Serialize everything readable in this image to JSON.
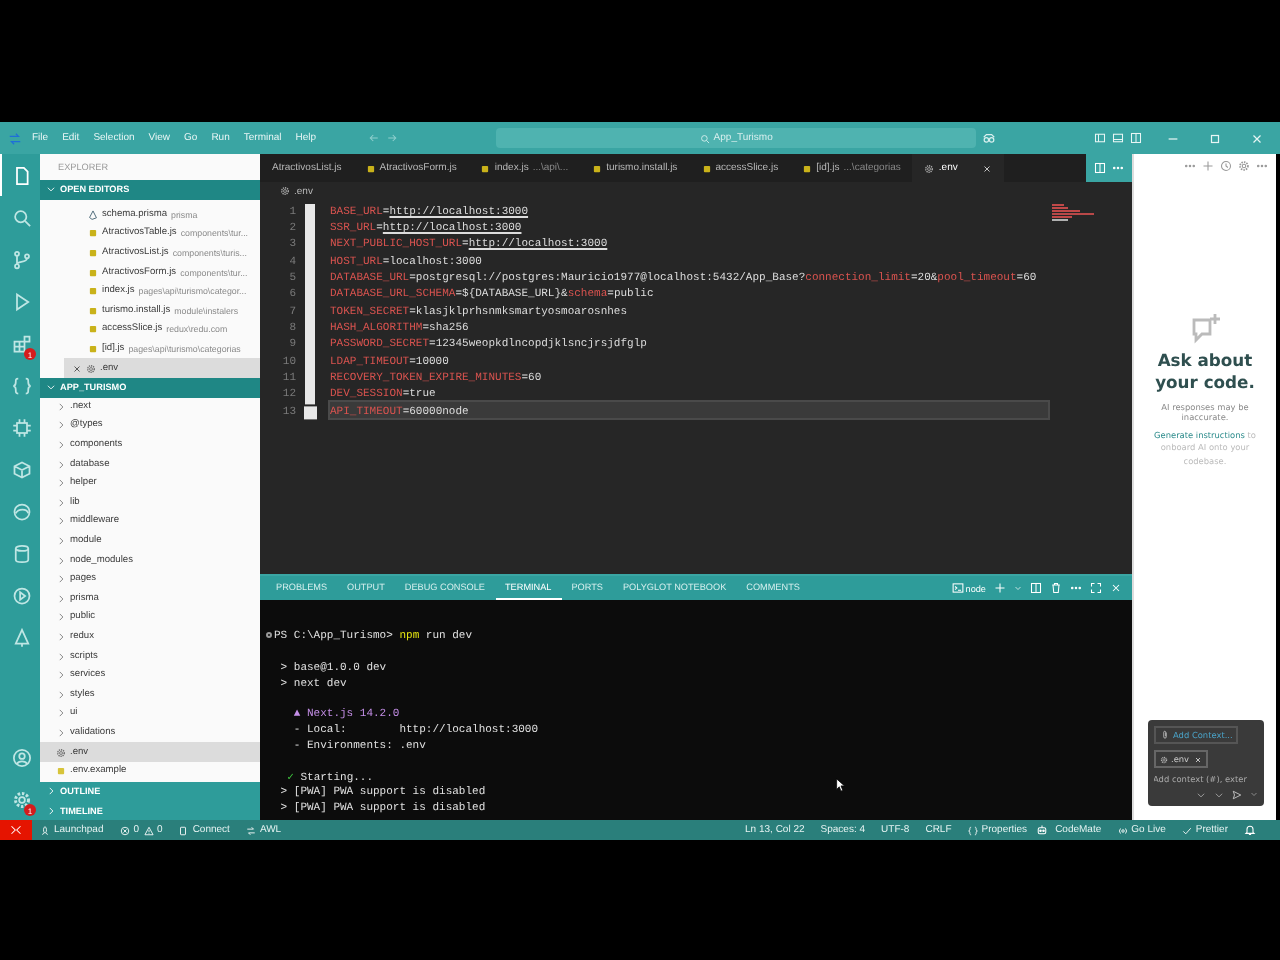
{
  "window": {
    "menu": [
      "File",
      "Edit",
      "Selection",
      "View",
      "Go",
      "Run",
      "Terminal",
      "Help"
    ],
    "search": "App_Turismo"
  },
  "activity_bar": {
    "top": [
      {
        "kind": "files",
        "selected": true
      },
      {
        "kind": "search",
        "selected": false
      },
      {
        "kind": "source-control",
        "selected": false
      },
      {
        "kind": "run",
        "selected": false
      },
      {
        "kind": "extensions",
        "selected": false,
        "badge": "1"
      },
      {
        "kind": "braces",
        "selected": false
      },
      {
        "kind": "chip",
        "selected": false
      },
      {
        "kind": "package",
        "selected": false
      },
      {
        "kind": "browser",
        "selected": false
      },
      {
        "kind": "database",
        "selected": false
      },
      {
        "kind": "play",
        "selected": false
      },
      {
        "kind": "tree",
        "selected": false
      }
    ],
    "bottom": [
      {
        "kind": "account",
        "selected": false
      },
      {
        "kind": "settings",
        "selected": false,
        "badge": "1"
      }
    ]
  },
  "sidebar": {
    "title": "EXPLORER",
    "open_editors": {
      "title": "OPEN EDITORS",
      "expanded": true,
      "items": [
        {
          "name": "schema.prisma",
          "path": "prisma",
          "kind": "prisma",
          "selected": false
        },
        {
          "name": "AtractivosTable.js",
          "path": "components\\tur...",
          "kind": "js",
          "selected": false
        },
        {
          "name": "AtractivosList.js",
          "path": "components\\turis...",
          "kind": "js",
          "selected": false
        },
        {
          "name": "AtractivosForm.js",
          "path": "components\\tur...",
          "kind": "js",
          "selected": false
        },
        {
          "name": "index.js",
          "path": "pages\\api\\turismo\\categor...",
          "kind": "js",
          "selected": false
        },
        {
          "name": "turismo.install.js",
          "path": "module\\instalers",
          "kind": "js",
          "selected": false
        },
        {
          "name": "accessSlice.js",
          "path": "redux\\redu.com",
          "kind": "js",
          "selected": false
        },
        {
          "name": "[id].js",
          "path": "pages\\api\\turismo\\categorias",
          "kind": "js",
          "selected": false
        },
        {
          "name": ".env",
          "kind": "env",
          "selected": true
        }
      ]
    },
    "project": {
      "title": "APP_TURISMO",
      "expanded": true,
      "items": [
        {
          "name": ".next",
          "kind": "folder",
          "expanded": false,
          "selected": false
        },
        {
          "name": "@types",
          "kind": "folder",
          "expanded": false,
          "selected": false
        },
        {
          "name": "components",
          "kind": "folder",
          "expanded": false,
          "selected": false
        },
        {
          "name": "database",
          "kind": "folder",
          "expanded": false,
          "selected": false
        },
        {
          "name": "helper",
          "kind": "folder",
          "expanded": false,
          "selected": false
        },
        {
          "name": "lib",
          "kind": "folder",
          "expanded": false,
          "selected": false
        },
        {
          "name": "middleware",
          "kind": "folder",
          "expanded": false,
          "selected": false
        },
        {
          "name": "module",
          "kind": "folder",
          "expanded": false,
          "selected": false
        },
        {
          "name": "node_modules",
          "kind": "folder",
          "expanded": false,
          "selected": false
        },
        {
          "name": "pages",
          "kind": "folder",
          "expanded": false,
          "selected": false
        },
        {
          "name": "prisma",
          "kind": "folder",
          "expanded": false,
          "selected": false
        },
        {
          "name": "public",
          "kind": "folder",
          "expanded": false,
          "selected": false
        },
        {
          "name": "redux",
          "kind": "folder",
          "expanded": false,
          "selected": false
        },
        {
          "name": "scripts",
          "kind": "folder",
          "expanded": false,
          "selected": false
        },
        {
          "name": "services",
          "kind": "folder",
          "expanded": false,
          "selected": false
        },
        {
          "name": "styles",
          "kind": "folder",
          "expanded": false,
          "selected": false
        },
        {
          "name": "ui",
          "kind": "folder",
          "expanded": false,
          "selected": false
        },
        {
          "name": "validations",
          "kind": "folder",
          "expanded": false,
          "selected": false
        },
        {
          "name": ".env",
          "kind": "env",
          "selected": true
        },
        {
          "name": ".env.example",
          "kind": "example",
          "selected": false
        }
      ]
    },
    "sections": [
      {
        "title": "OUTLINE",
        "expanded": false
      },
      {
        "title": "TIMELINE",
        "expanded": false
      }
    ]
  },
  "editor": {
    "tabs": [
      {
        "name": "AtractivosList.js",
        "selected": false
      },
      {
        "name": "AtractivosForm.js",
        "kind": "js",
        "selected": false
      },
      {
        "name": "index.js",
        "detail": "...\\api\\...",
        "kind": "js",
        "selected": false
      },
      {
        "name": "turismo.install.js",
        "kind": "js",
        "selected": false
      },
      {
        "name": "accessSlice.js",
        "kind": "js",
        "selected": false
      },
      {
        "name": "[id].js",
        "detail": "...\\categorias",
        "kind": "js",
        "selected": false
      },
      {
        "name": ".env",
        "kind": "env",
        "selected": true
      }
    ],
    "breadcrumb": ".env",
    "lines": [
      {
        "number": "1",
        "current": false,
        "tokens": [
          {
            "text": "BASE_URL",
            "kind": "key"
          },
          {
            "text": "=",
            "kind": "plain"
          },
          {
            "text": "http://localhost:3000",
            "kind": "link"
          }
        ]
      },
      {
        "number": "2",
        "current": false,
        "tokens": [
          {
            "text": "SSR_URL",
            "kind": "key"
          },
          {
            "text": "=",
            "kind": "plain"
          },
          {
            "text": "http://localhost:3000",
            "kind": "link"
          }
        ]
      },
      {
        "number": "3",
        "current": false,
        "tokens": [
          {
            "text": "NEXT_PUBLIC_HOST_URL",
            "kind": "key"
          },
          {
            "text": "=",
            "kind": "plain"
          },
          {
            "text": "http://localhost:3000",
            "kind": "link"
          }
        ]
      },
      {
        "number": "4",
        "current": false,
        "tokens": [
          {
            "text": "HOST_URL",
            "kind": "key"
          },
          {
            "text": "=localhost:3000",
            "kind": "plain"
          }
        ]
      },
      {
        "number": "5",
        "current": false,
        "tokens": [
          {
            "text": "DATABASE_URL",
            "kind": "key"
          },
          {
            "text": "=postgresql://postgres:Mauricio1977@localhost:5432/App_Base?",
            "kind": "plain"
          },
          {
            "text": "connection_limit",
            "kind": "key"
          },
          {
            "text": "=20&",
            "kind": "plain"
          },
          {
            "text": "pool_timeout",
            "kind": "key"
          },
          {
            "text": "=60",
            "kind": "plain"
          }
        ]
      },
      {
        "number": "6",
        "current": false,
        "tokens": [
          {
            "text": "DATABASE_URL_SCHEMA",
            "kind": "key"
          },
          {
            "text": "=${DATABASE_URL}&",
            "kind": "plain"
          },
          {
            "text": "schema",
            "kind": "key"
          },
          {
            "text": "=public",
            "kind": "plain"
          }
        ]
      },
      {
        "number": "7",
        "current": false,
        "tokens": [
          {
            "text": "TOKEN_SECRET",
            "kind": "key"
          },
          {
            "text": "=klasjklprhsnmksmartyosmoarosnhes",
            "kind": "plain"
          }
        ]
      },
      {
        "number": "8",
        "current": false,
        "tokens": [
          {
            "text": "HASH_ALGORITHM",
            "kind": "key"
          },
          {
            "text": "=sha256",
            "kind": "plain"
          }
        ]
      },
      {
        "number": "9",
        "current": false,
        "tokens": [
          {
            "text": "PASSWORD_SECRET",
            "kind": "key"
          },
          {
            "text": "=12345weopkdlncopdjklsncjrsjdfglp",
            "kind": "plain"
          }
        ]
      },
      {
        "number": "10",
        "current": false,
        "tokens": [
          {
            "text": "LDAP_TIMEOUT",
            "kind": "key"
          },
          {
            "text": "=10000",
            "kind": "plain"
          }
        ]
      },
      {
        "number": "11",
        "current": false,
        "tokens": [
          {
            "text": "RECOVERY_TOKEN_EXPIRE_MINUTES",
            "kind": "key"
          },
          {
            "text": "=60",
            "kind": "plain"
          }
        ]
      },
      {
        "number": "12",
        "current": false,
        "tokens": [
          {
            "text": "DEV_SESSION",
            "kind": "key"
          },
          {
            "text": "=true",
            "kind": "plain"
          }
        ]
      },
      {
        "number": "13",
        "current": true,
        "tokens": [
          {
            "text": "API_TIMEOUT",
            "kind": "key"
          },
          {
            "text": "=60000node",
            "kind": "plain"
          }
        ]
      }
    ]
  },
  "panel": {
    "tabs": [
      {
        "label": "PROBLEMS",
        "selected": false
      },
      {
        "label": "OUTPUT",
        "selected": false
      },
      {
        "label": "DEBUG CONSOLE",
        "selected": false
      },
      {
        "label": "TERMINAL",
        "selected": true
      },
      {
        "label": "PORTS",
        "selected": false
      },
      {
        "label": "POLYGLOT NOTEBOOK",
        "selected": false
      },
      {
        "label": "COMMENTS",
        "selected": false
      }
    ],
    "terminal_name": "node",
    "blocks": [
      [
        {
          "kind": "prompt",
          "tokens": [
            {
              "text": "PS C:\\App_Turismo> ",
              "kind": "plain"
            },
            {
              "text": "npm",
              "kind": "command"
            },
            {
              "text": " run dev",
              "kind": "plain"
            }
          ]
        }
      ],
      [
        {
          "kind": "output",
          "tokens": [
            {
              "text": " > base@1.0.0 dev",
              "kind": "plain"
            }
          ]
        },
        {
          "kind": "output",
          "tokens": [
            {
              "text": " > next dev",
              "kind": "plain"
            }
          ]
        }
      ],
      [
        {
          "kind": "output",
          "tokens": [
            {
              "text": "   ▲ Next.js 14.2.0",
              "kind": "accent"
            }
          ]
        },
        {
          "kind": "output",
          "tokens": [
            {
              "text": "   - Local:        http://localhost:3000",
              "kind": "plain"
            }
          ]
        },
        {
          "kind": "output",
          "tokens": [
            {
              "text": "   - Environments: .env",
              "kind": "plain"
            }
          ]
        }
      ],
      [
        {
          "kind": "output",
          "tokens": [
            {
              "text": "  ✓",
              "kind": "success"
            },
            {
              "text": " Starting...",
              "kind": "plain"
            }
          ]
        },
        {
          "kind": "output",
          "tokens": [
            {
              "text": " > [PWA] PWA support is disabled",
              "kind": "plain"
            }
          ]
        },
        {
          "kind": "output",
          "tokens": [
            {
              "text": " > [PWA] PWA support is disabled",
              "kind": "plain"
            }
          ]
        }
      ]
    ]
  },
  "chat": {
    "title": "Ask about your code.",
    "disclaimer": "AI responses may be inaccurate.",
    "hint_link": "Generate instructions",
    "hint_text": " to onboard AI onto your codebase.",
    "add_context": "Add Context...",
    "attachment": ".env",
    "placeholder": "Add context (#), exter"
  },
  "status_bar": {
    "left": [
      {
        "kind": "remote"
      },
      {
        "kind": "launchpad",
        "text": "Launchpad"
      },
      {
        "kind": "problems",
        "errors": "0",
        "warnings": "0"
      },
      {
        "kind": "connect",
        "text": "Connect"
      },
      {
        "kind": "sync",
        "text": "AWL"
      }
    ],
    "right": [
      {
        "kind": "plain",
        "text": "Ln 13, Col 22"
      },
      {
        "kind": "plain",
        "text": "Spaces: 4"
      },
      {
        "kind": "plain",
        "text": "UTF-8"
      },
      {
        "kind": "plain",
        "text": "CRLF"
      },
      {
        "kind": "properties",
        "text": "Properties"
      },
      {
        "kind": "codemate-icon"
      },
      {
        "kind": "plain",
        "text": "CodeMate"
      },
      {
        "kind": "golive",
        "text": "Go Live"
      },
      {
        "kind": "prettier",
        "text": "Prettier"
      },
      {
        "kind": "notifications"
      }
    ]
  }
}
